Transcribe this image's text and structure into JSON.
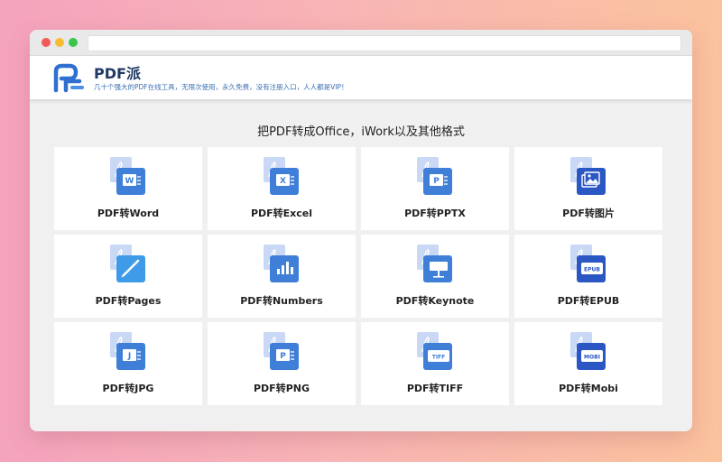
{
  "header": {
    "brand": "PDF派",
    "tagline": "几十个强大的PDF在线工具，无限次使用，永久免费，没有注册入口，人人都是VIP！"
  },
  "main": {
    "title": "把PDF转成Office，iWork以及其他格式"
  },
  "tools": [
    {
      "label": "PDF转Word",
      "icon": "word-icon",
      "glyph": "W",
      "color": "#3f7fd8"
    },
    {
      "label": "PDF转Excel",
      "icon": "excel-icon",
      "glyph": "X",
      "color": "#3f7fd8"
    },
    {
      "label": "PDF转PPTX",
      "icon": "pptx-icon",
      "glyph": "P",
      "color": "#3f7fd8"
    },
    {
      "label": "PDF转图片",
      "icon": "image-icon",
      "glyph": "",
      "color": "#2b57c4"
    },
    {
      "label": "PDF转Pages",
      "icon": "pages-icon",
      "glyph": "",
      "color": "#3f9be8"
    },
    {
      "label": "PDF转Numbers",
      "icon": "numbers-icon",
      "glyph": "",
      "color": "#3f7fd8"
    },
    {
      "label": "PDF转Keynote",
      "icon": "keynote-icon",
      "glyph": "",
      "color": "#3f7fd8"
    },
    {
      "label": "PDF转EPUB",
      "icon": "epub-icon",
      "glyph": "EPUB",
      "color": "#2b57c4"
    },
    {
      "label": "PDF转JPG",
      "icon": "jpg-icon",
      "glyph": "J",
      "color": "#3f7fd8"
    },
    {
      "label": "PDF转PNG",
      "icon": "png-icon",
      "glyph": "P",
      "color": "#3f7fd8"
    },
    {
      "label": "PDF转TIFF",
      "icon": "tiff-icon",
      "glyph": "TIFF",
      "color": "#3f7fd8"
    },
    {
      "label": "PDF转Mobi",
      "icon": "mobi-icon",
      "glyph": "MOBI",
      "color": "#2b57c4"
    }
  ],
  "colors": {
    "accent": "#3f7fd8",
    "accent_dark": "#2b57c4",
    "pdf_backdrop": "#c9d8f5"
  }
}
